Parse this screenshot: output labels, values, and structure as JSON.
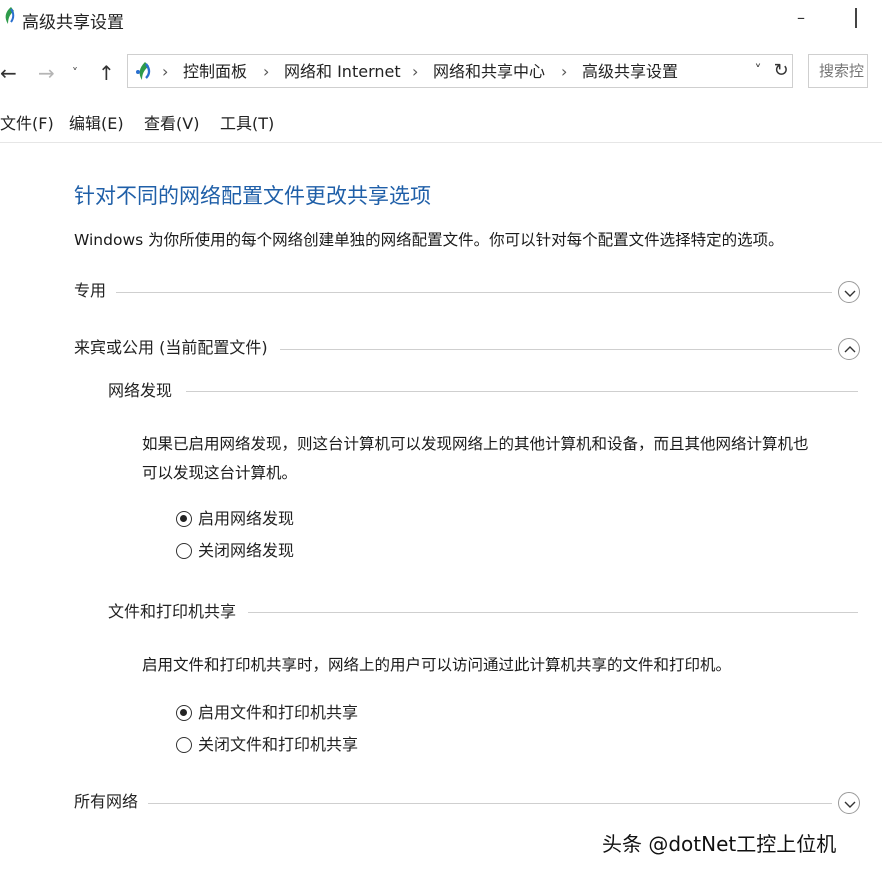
{
  "window": {
    "title": "高级共享设置"
  },
  "nav": {
    "back_glyph": "←",
    "forward_glyph": "→",
    "recent_glyph": "˅",
    "up_glyph": "↑"
  },
  "address": {
    "crumbs": [
      "控制面板",
      "网络和 Internet",
      "网络和共享中心",
      "高级共享设置"
    ],
    "separator": "›",
    "dropdown_glyph": "˅",
    "refresh_glyph": "↻"
  },
  "search": {
    "placeholder": "搜索控"
  },
  "menu": {
    "items": [
      "文件(F)",
      "编辑(E)",
      "查看(V)",
      "工具(T)"
    ]
  },
  "content": {
    "title": "针对不同的网络配置文件更改共享选项",
    "description": "Windows 为你所使用的每个网络创建单独的网络配置文件。你可以针对每个配置文件选择特定的选项。",
    "sections": [
      {
        "label": "专用",
        "state": "collapsed"
      },
      {
        "label": "来宾或公用 (当前配置文件)",
        "state": "expanded"
      },
      {
        "label": "所有网络",
        "state": "collapsed"
      }
    ],
    "network_discovery": {
      "heading": "网络发现",
      "description_line1": "如果已启用网络发现，则这台计算机可以发现网络上的其他计算机和设备，而且其他网络计算机也",
      "description_line2": "可以发现这台计算机。",
      "options": [
        {
          "label": "启用网络发现",
          "selected": true
        },
        {
          "label": "关闭网络发现",
          "selected": false
        }
      ]
    },
    "file_printer_sharing": {
      "heading": "文件和打印机共享",
      "description": "启用文件和打印机共享时，网络上的用户可以访问通过此计算机共享的文件和打印机。",
      "options": [
        {
          "label": "启用文件和打印机共享",
          "selected": true
        },
        {
          "label": "关闭文件和打印机共享",
          "selected": false
        }
      ]
    }
  },
  "watermark": "头条 @dotNet工控上位机",
  "colors": {
    "title_blue": "#1f5fa8",
    "icon_green": "#2e9b4a",
    "icon_blue": "#2a6fcf"
  }
}
